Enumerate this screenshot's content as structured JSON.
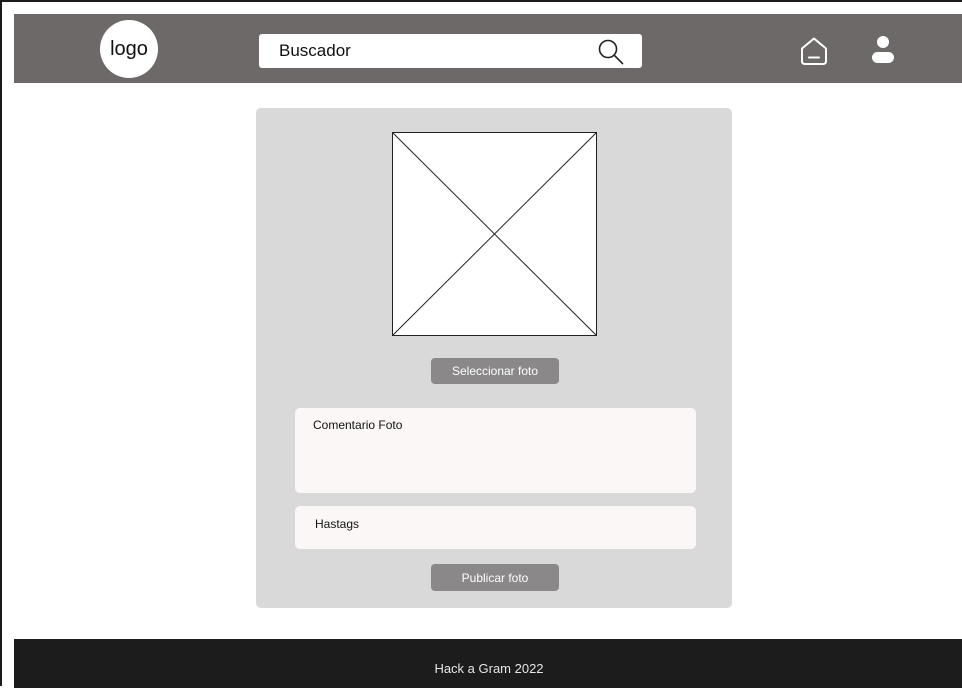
{
  "header": {
    "logo_text": "logo",
    "search": {
      "placeholder": "Buscador",
      "value": ""
    },
    "icons": {
      "search": "search-icon",
      "home": "home-icon",
      "user": "user-icon"
    },
    "background_color": "#6e6969"
  },
  "upload_form": {
    "photo_placeholder_icon": "image-placeholder-icon",
    "select_photo_label": "Seleccionar foto",
    "comment": {
      "placeholder": "Comentario Foto",
      "value": ""
    },
    "hashtags": {
      "placeholder": "Hastags",
      "value": ""
    },
    "publish_label": "Publicar foto"
  },
  "footer": {
    "text": "Hack a Gram 2022"
  },
  "colors": {
    "card_bg": "#d9d9d9",
    "button_bg": "#8a8888",
    "input_bg": "#fbf7f6",
    "footer_bg": "#1c1c1c"
  }
}
